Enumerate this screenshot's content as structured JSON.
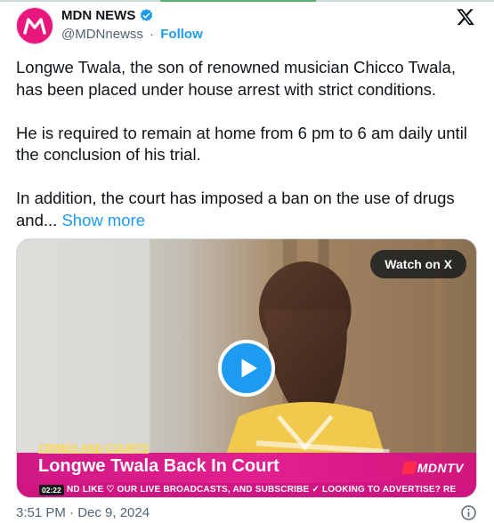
{
  "account": {
    "name": "MDN NEWS",
    "handle": "@MDNnewss",
    "separator": "·",
    "follow_label": "Follow",
    "verified": true,
    "avatar_letter": "M"
  },
  "tweet": {
    "paragraphs": [
      "Longwe Twala, the son of renowned musician Chicco Twala, has been placed under house arrest with strict conditions.",
      "He is required to remain at home from 6 pm to 6 am daily until the conclusion of his trial."
    ],
    "truncated_paragraph": "In addition, the court has imposed a ban on the use of drugs and...",
    "show_more_label": "Show more"
  },
  "media": {
    "watch_label": "Watch on X",
    "category": "CRIMES AND COURTS",
    "headline": "Longwe Twala Back In Court",
    "brand": "MDNTV",
    "timestamp": "02:22",
    "ticker": "ND LIKE ♡ OUR LIVE BROADCASTS, AND SUBSCRIBE ✓   LOOKING TO ADVERTISE? RE"
  },
  "footer": {
    "time": "3:51 PM · Dec 9, 2024"
  },
  "icons": {
    "platform": "x-logo-icon",
    "verified": "verified-badge-icon",
    "play": "play-icon",
    "info": "info-icon"
  },
  "colors": {
    "accent_blue": "#1d9bf0",
    "brand_pink": "#e8177e",
    "text": "#0f1419",
    "muted": "#536471"
  }
}
